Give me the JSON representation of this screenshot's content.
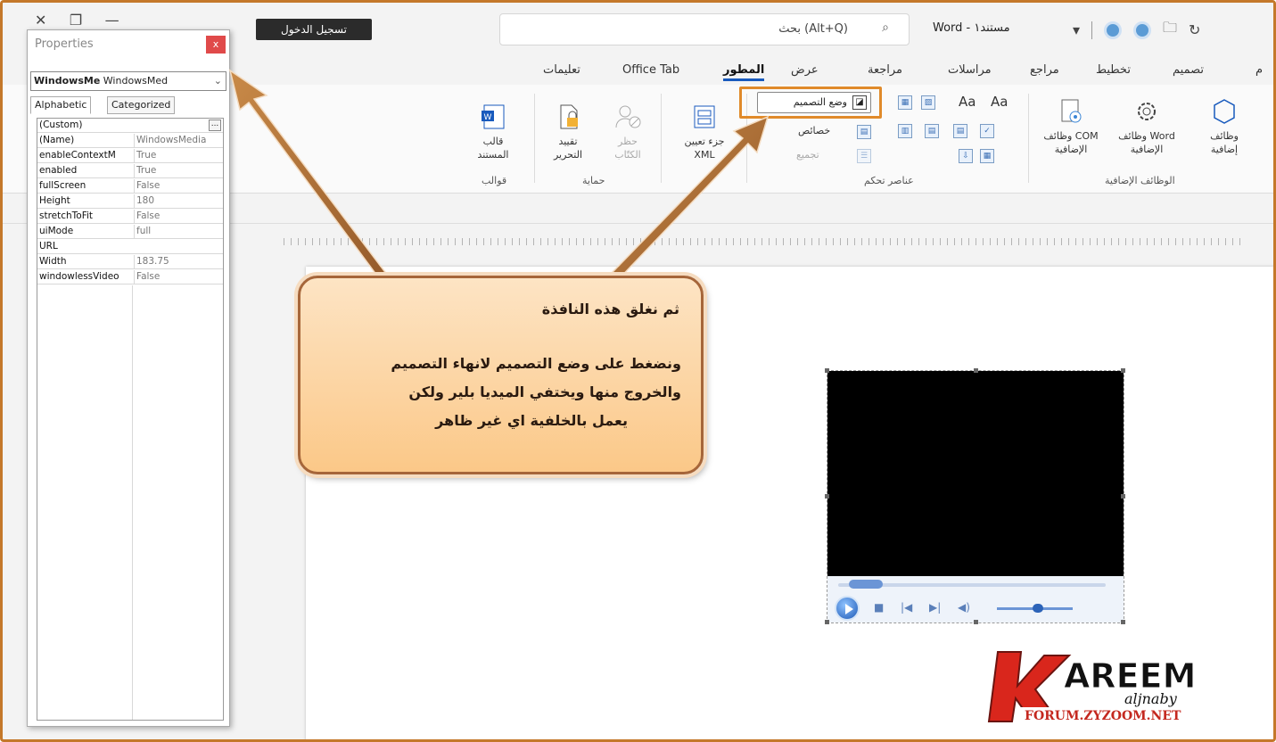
{
  "titlebar": {
    "signin_label": "تسجيل الدخول",
    "search_text": "بحث (Alt+Q)",
    "doc_title": "Word - مستند١"
  },
  "tabs": [
    "تعليمات",
    "Office Tab",
    "المطور",
    "عرض",
    "مراجعة",
    "مراسلات",
    "مراجع",
    "تخطيط",
    "تصميم",
    "م"
  ],
  "ribbon": {
    "templates_btn": "قالب المستند",
    "templates_group": "قوالب",
    "restrict_editing": "تقييد التحرير",
    "block_authors": "حظر الكتّاب",
    "protect_group": "حماية",
    "xml_mapping": "جزء تعيين XML",
    "design_mode": "وضع التصميم",
    "properties": "خصائص",
    "group": "تجميع",
    "controls_group": "عناصر تحكم",
    "com_addins": "وظائف COM الإضافية",
    "word_addins": "وظائف Word الإضافية",
    "addins": "وظائف إضافية",
    "addins_group": "الوظائف الإضافية",
    "aa": "Aa"
  },
  "properties_panel": {
    "title": "Properties",
    "close": "x",
    "object_name": "WindowsMe",
    "object_type": "WindowsMed",
    "tab_alphabetic": "Alphabetic",
    "tab_categorized": "Categorized",
    "rows": [
      {
        "key": "(Custom)",
        "value": ""
      },
      {
        "key": "(Name)",
        "value": "WindowsMedia"
      },
      {
        "key": "enableContextM",
        "value": "True"
      },
      {
        "key": "enabled",
        "value": "True"
      },
      {
        "key": "fullScreen",
        "value": "False"
      },
      {
        "key": "Height",
        "value": "180"
      },
      {
        "key": "stretchToFit",
        "value": "False"
      },
      {
        "key": "uiMode",
        "value": "full"
      },
      {
        "key": "URL",
        "value": ""
      },
      {
        "key": "Width",
        "value": "183.75"
      },
      {
        "key": "windowlessVideo",
        "value": "False"
      }
    ],
    "custom_button": "..."
  },
  "callout": {
    "line1": "ثم نغلق هذه النافذة",
    "line2": "ونضغط على وضع التصميم لانهاء التصميم",
    "line3": "والخروج منها ويختفي الميديا بلير ولكن",
    "line4": "يعمل بالخلفية اي غير ظاهر"
  },
  "logo": {
    "k": "K",
    "name": "AREEM",
    "sub": "aljnaby",
    "site": "FORUM.ZYZOOM.NET"
  },
  "colors": {
    "frame": "#c4782a",
    "highlight": "#e08a2a",
    "arrow": "#b8742e",
    "callout_top": "#fde4c4",
    "callout_bottom": "#fbc888",
    "accent": "#185abd"
  }
}
